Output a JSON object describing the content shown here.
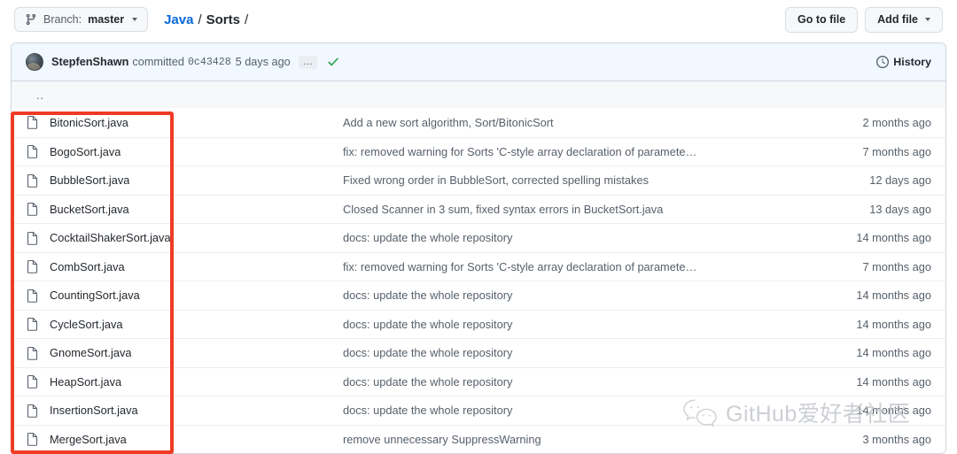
{
  "topbar": {
    "branch": {
      "prefix": "Branch:",
      "name": "master",
      "icon": "git-branch-icon"
    },
    "breadcrumb": {
      "root": "Java",
      "sep": "/",
      "current": "Sorts",
      "trailing": "/"
    },
    "go_to_file": "Go to file",
    "add_file": "Add file"
  },
  "commit": {
    "author": "StepfenShawn",
    "verb": "committed",
    "sha": "0c43428",
    "when": "5 days ago",
    "ellipsis": "…",
    "history_label": "History",
    "check_color": "#2da44e",
    "bar_background": "#f1f8ff"
  },
  "listing": {
    "parent_dir": "..",
    "rows": [
      {
        "name": "BitonicSort.java",
        "message": "Add a new sort algorithm, Sort/BitonicSort",
        "time": "2 months ago"
      },
      {
        "name": "BogoSort.java",
        "message": "fix: removed warning for Sorts 'C-style array declaration of paramete…",
        "time": "7 months ago"
      },
      {
        "name": "BubbleSort.java",
        "message": "Fixed wrong order in BubbleSort, corrected spelling mistakes",
        "time": "12 days ago"
      },
      {
        "name": "BucketSort.java",
        "message": "Closed Scanner in 3 sum, fixed syntax errors in BucketSort.java",
        "time": "13 days ago"
      },
      {
        "name": "CocktailShakerSort.java",
        "message": "docs: update the whole repository",
        "time": "14 months ago"
      },
      {
        "name": "CombSort.java",
        "message": "fix: removed warning for Sorts 'C-style array declaration of paramete…",
        "time": "7 months ago"
      },
      {
        "name": "CountingSort.java",
        "message": "docs: update the whole repository",
        "time": "14 months ago"
      },
      {
        "name": "CycleSort.java",
        "message": "docs: update the whole repository",
        "time": "14 months ago"
      },
      {
        "name": "GnomeSort.java",
        "message": "docs: update the whole repository",
        "time": "14 months ago"
      },
      {
        "name": "HeapSort.java",
        "message": "docs: update the whole repository",
        "time": "14 months ago"
      },
      {
        "name": "InsertionSort.java",
        "message": "docs: update the whole repository",
        "time": "14 months ago"
      },
      {
        "name": "MergeSort.java",
        "message": "remove unnecessary SuppressWarning",
        "time": "3 months ago"
      }
    ]
  },
  "annotation": {
    "color": "#ef3b25"
  },
  "watermark": {
    "text": "GitHub爱好者社区",
    "icon": "wechat-icon",
    "color": "#c8ccd1"
  }
}
